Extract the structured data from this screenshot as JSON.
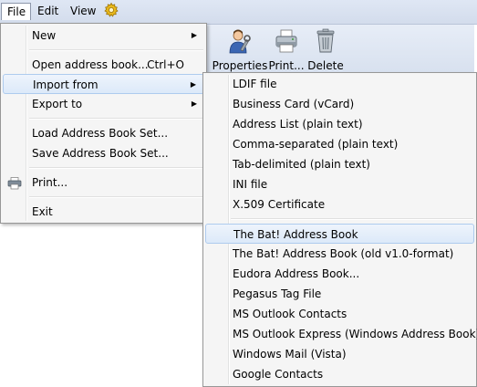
{
  "menubar": {
    "file": "File",
    "edit": "Edit",
    "view": "View",
    "gear_icon": "gear-icon"
  },
  "toolbar": {
    "properties": "Properties",
    "print": "Print...",
    "delete": "Delete"
  },
  "file_menu": {
    "items": [
      {
        "label": "New",
        "has_submenu": true
      },
      {
        "label": "Open address book...",
        "shortcut": "Ctrl+O"
      },
      {
        "label": "Import from",
        "has_submenu": true,
        "highlighted": true
      },
      {
        "label": "Export to",
        "has_submenu": true
      },
      {
        "label": "Load Address Book Set..."
      },
      {
        "label": "Save Address Book Set..."
      },
      {
        "label": "Print...",
        "icon": "printer-icon"
      },
      {
        "label": "Exit"
      }
    ]
  },
  "import_submenu": {
    "items": [
      {
        "label": "LDIF file"
      },
      {
        "label": "Business Card (vCard)"
      },
      {
        "label": "Address List (plain text)"
      },
      {
        "label": "Comma-separated (plain text)"
      },
      {
        "label": "Tab-delimited (plain text)"
      },
      {
        "label": "INI file"
      },
      {
        "label": "X.509 Certificate"
      },
      {
        "label": "The Bat! Address Book",
        "highlighted": true
      },
      {
        "label": "The Bat! Address Book (old v1.0-format)"
      },
      {
        "label": "Eudora Address Book..."
      },
      {
        "label": "Pegasus Tag File"
      },
      {
        "label": "MS Outlook Contacts"
      },
      {
        "label": "MS Outlook Express (Windows Address Book)"
      },
      {
        "label": "Windows Mail (Vista)"
      },
      {
        "label": "Google Contacts"
      }
    ]
  }
}
